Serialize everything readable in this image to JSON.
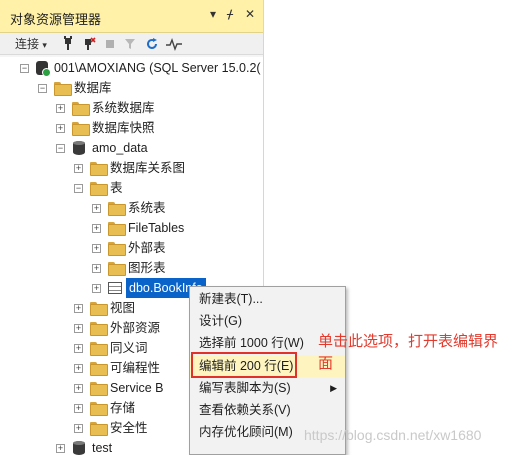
{
  "panel": {
    "title": "对象资源管理器",
    "title_icons": [
      "▾",
      "ᚋ",
      "✕"
    ],
    "toolbar": {
      "connect_label": "连接",
      "connect_caret": "▾"
    }
  },
  "tree": {
    "server": "001\\AMOXIANG (SQL Server 15.0.2(",
    "databases": "数据库",
    "system_databases": "系统数据库",
    "db_snapshots": "数据库快照",
    "db_name": "amo_data",
    "db_diagrams": "数据库关系图",
    "tables": "表",
    "system_tables": "系统表",
    "filetables": "FileTables",
    "external_tables": "外部表",
    "graph_tables": "图形表",
    "selected_table": "dbo.BookInfo",
    "views": "视图",
    "external_resources": "外部资源",
    "synonyms": "同义词",
    "programmability": "可编程性",
    "service_broker": "Service B",
    "storage": "存储",
    "security": "安全性",
    "test_db": "test"
  },
  "context_menu": {
    "items": [
      "新建表(T)...",
      "设计(G)",
      "选择前 1000 行(W)",
      "编辑前 200 行(E)",
      "编写表脚本为(S)",
      "查看依赖关系(V)",
      "内存优化顾问(M)"
    ],
    "submenu_arrow": "▶"
  },
  "annotation": "单击此选项，打开表编辑界面",
  "watermark": "https://blog.csdn.net/xw1680",
  "colors": {
    "title_bar": "#fff1a8",
    "selection": "#0a63c9",
    "menu_hover": "#fdf4bf",
    "annotation": "#e23b2e"
  }
}
